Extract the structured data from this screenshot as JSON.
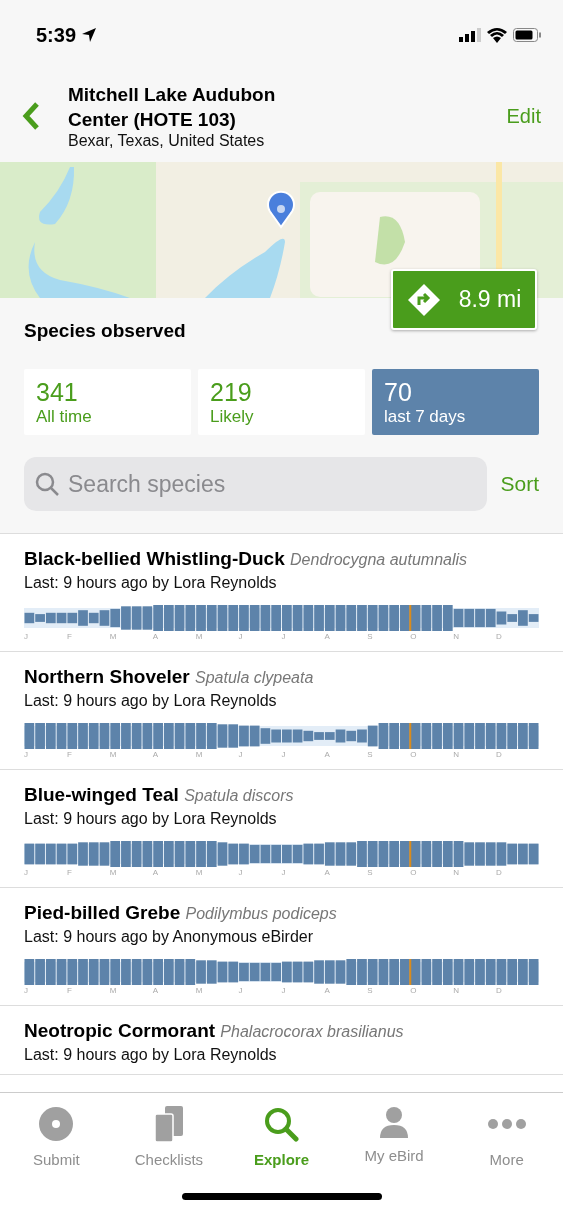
{
  "status_bar": {
    "time": "5:39"
  },
  "header": {
    "title": "Mitchell Lake Audubon Center (HOTE 103)",
    "subtitle": "Bexar, Texas, United States",
    "action": "Edit"
  },
  "map": {
    "distance": "8.9 mi"
  },
  "species_observed": {
    "title": "Species observed",
    "stats": [
      {
        "count": "341",
        "label": "All time",
        "selected": false
      },
      {
        "count": "219",
        "label": "Likely",
        "selected": false
      },
      {
        "count": "70",
        "label": "last 7 days",
        "selected": true
      }
    ]
  },
  "search": {
    "placeholder": "Search species",
    "sort": "Sort"
  },
  "species": [
    {
      "name": "Black-bellied Whistling-Duck",
      "scientific": "Dendrocygna autumnalis",
      "last": "Last: 9 hours ago by Lora Reynolds",
      "months": [
        "J",
        "F",
        "M",
        "A",
        "M",
        "J",
        "J",
        "A",
        "S",
        "O",
        "N",
        "D"
      ]
    },
    {
      "name": "Northern Shoveler",
      "scientific": "Spatula clypeata",
      "last": "Last: 9 hours ago by Lora Reynolds",
      "months": [
        "J",
        "F",
        "M",
        "A",
        "M",
        "J",
        "J",
        "A",
        "S",
        "O",
        "N",
        "D"
      ]
    },
    {
      "name": "Blue-winged Teal",
      "scientific": "Spatula discors",
      "last": "Last: 9 hours ago by Lora Reynolds",
      "months": [
        "J",
        "F",
        "M",
        "A",
        "M",
        "J",
        "J",
        "A",
        "S",
        "O",
        "N",
        "D"
      ]
    },
    {
      "name": "Pied-billed Grebe",
      "scientific": "Podilymbus podiceps",
      "last": "Last: 9 hours ago by Anonymous eBirder",
      "months": [
        "J",
        "F",
        "M",
        "A",
        "M",
        "J",
        "J",
        "A",
        "S",
        "O",
        "N",
        "D"
      ]
    },
    {
      "name": "Neotropic Cormorant",
      "scientific": "Phalacrocorax brasilianus",
      "last": "Last: 9 hours ago by Lora Reynolds"
    }
  ],
  "tabs": [
    {
      "kind": "submit",
      "label": "Submit",
      "selected": false
    },
    {
      "kind": "checklists",
      "label": "Checklists",
      "selected": false
    },
    {
      "kind": "explore",
      "label": "Explore",
      "selected": true
    },
    {
      "kind": "profile",
      "label": "My eBird",
      "selected": false
    },
    {
      "kind": "more",
      "label": "More",
      "selected": false
    }
  ]
}
